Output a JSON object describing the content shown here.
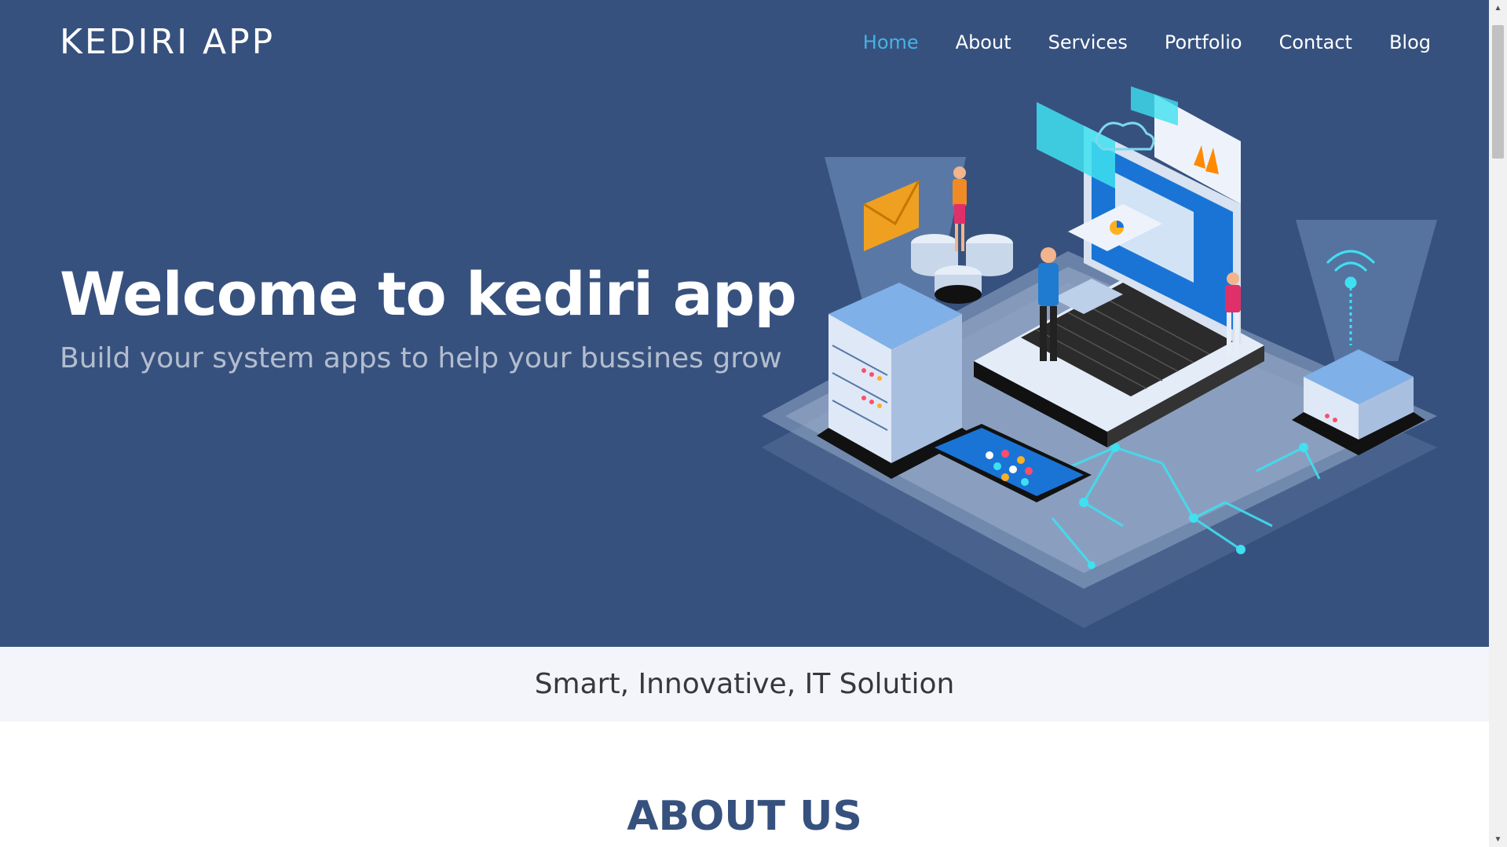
{
  "header": {
    "brand": "KEDIRI APP",
    "nav": [
      {
        "label": "Home",
        "active": true
      },
      {
        "label": "About",
        "active": false
      },
      {
        "label": "Services",
        "active": false
      },
      {
        "label": "Portfolio",
        "active": false
      },
      {
        "label": "Contact",
        "active": false
      },
      {
        "label": "Blog",
        "active": false
      }
    ]
  },
  "hero": {
    "title": "Welcome to kediri app",
    "subtitle": "Build your system apps to help your bussines grow"
  },
  "strip": {
    "text": "Smart, Innovative, IT Solution"
  },
  "about": {
    "title": "ABOUT US"
  },
  "colors": {
    "hero_bg": "#37517e",
    "accent": "#47b2e4",
    "strip_bg": "#f3f5fa",
    "heading": "#37517e"
  }
}
